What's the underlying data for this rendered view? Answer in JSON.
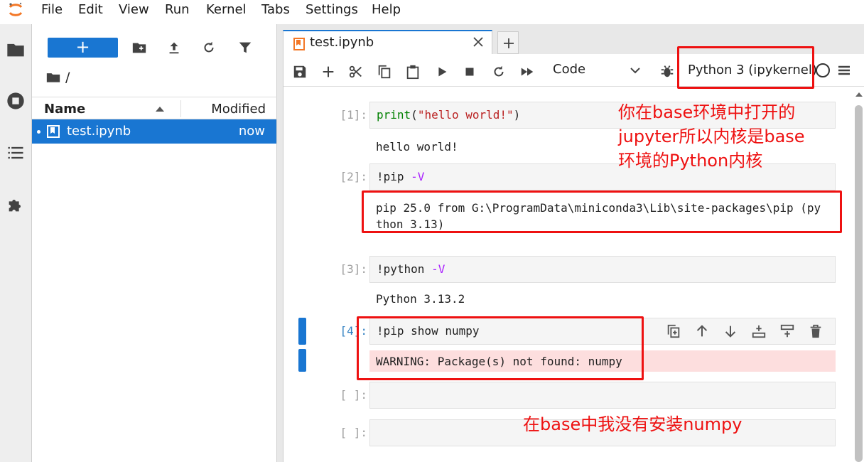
{
  "menubar": {
    "items": [
      "File",
      "Edit",
      "View",
      "Run",
      "Kernel",
      "Tabs",
      "Settings",
      "Help"
    ]
  },
  "activity_bar": {
    "icons": [
      "folder-icon",
      "running-icon",
      "table-of-contents-icon",
      "extension-icon"
    ]
  },
  "file_browser": {
    "new_button_label": "+",
    "path": "/",
    "columns": {
      "name": "Name",
      "modified": "Modified"
    },
    "files": [
      {
        "name": "test.ipynb",
        "modified": "now"
      }
    ]
  },
  "tabs": [
    {
      "label": "test.ipynb"
    }
  ],
  "notebook_toolbar": {
    "cell_type": "Code",
    "kernel_name": "Python 3 (ipykernel)"
  },
  "cells": [
    {
      "prompt": "[1]:",
      "input_parts": {
        "func": "print",
        "open": "(",
        "str": "\"hello world!\"",
        "close": ")"
      },
      "output": "hello world!"
    },
    {
      "prompt": "[2]:",
      "input_parts": {
        "bang": "!pip ",
        "flag": "-V"
      },
      "output": "pip 25.0 from G:\\ProgramData\\miniconda3\\Lib\\site-packages\\pip (py\nthon 3.13)"
    },
    {
      "prompt": "[3]:",
      "input_parts": {
        "bang": "!python ",
        "flag": "-V"
      },
      "output": "Python 3.13.2"
    },
    {
      "prompt": "[4]:",
      "input": "!pip show numpy",
      "output": "WARNING: Package(s) not found: numpy"
    },
    {
      "prompt": "[ ]:",
      "input": ""
    },
    {
      "prompt": "[ ]:",
      "input": ""
    }
  ],
  "annotations": {
    "kernel_note_line1": "你在base环境中打开的",
    "kernel_note_line2": "jupyter所以内核是base",
    "kernel_note_line3": "环境的Python内核",
    "numpy_note": "在base中我没有安装numpy"
  },
  "colors": {
    "accent": "#1976d2",
    "annotation_red": "#ee1111",
    "warning_bg": "#fddede"
  }
}
